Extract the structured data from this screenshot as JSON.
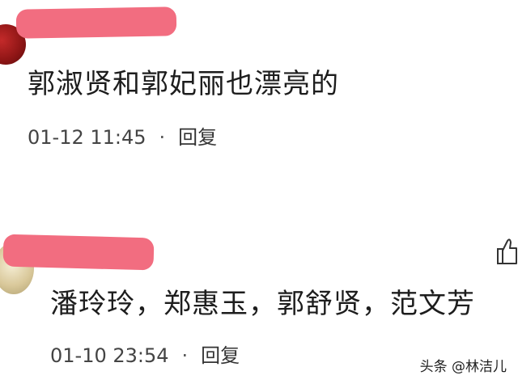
{
  "comments": [
    {
      "text": "郭淑贤和郭妃丽也漂亮的",
      "time": "01-12 11:45",
      "dot": "·",
      "reply": "回复"
    },
    {
      "text": "潘玲玲，郑惠玉，郭舒贤，范文芳",
      "time": "01-10 23:54",
      "dot": "·",
      "reply": "回复"
    }
  ],
  "watermark": "头条 @林洁儿",
  "icons": {
    "like": "thumbs-up-icon"
  },
  "colors": {
    "redaction": "#f26d80",
    "avatar1": "#9c1f1f",
    "avatar2": "#d9c89a"
  }
}
